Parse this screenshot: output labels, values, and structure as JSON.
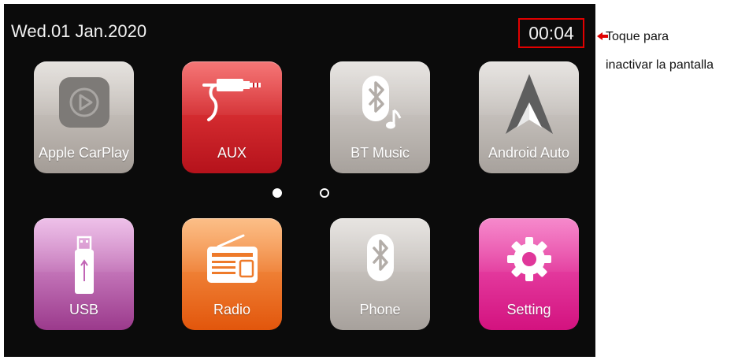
{
  "status_bar": {
    "date": "Wed.01 Jan.2020",
    "clock": "00:04"
  },
  "apps": [
    {
      "label": "Apple CarPlay",
      "icon": "carplay-icon"
    },
    {
      "label": "AUX",
      "icon": "aux-cable-icon"
    },
    {
      "label": "BT Music",
      "icon": "bluetooth-music-icon"
    },
    {
      "label": "Android Auto",
      "icon": "android-auto-icon"
    },
    {
      "label": "USB",
      "icon": "usb-drive-icon"
    },
    {
      "label": "Radio",
      "icon": "radio-icon"
    },
    {
      "label": "Phone",
      "icon": "bluetooth-phone-icon"
    },
    {
      "label": "Setting",
      "icon": "gear-icon"
    }
  ],
  "pager": {
    "pages": 2,
    "current": 1
  },
  "annotation": {
    "line1": "Toque para",
    "line2": "inactivar la pantalla",
    "color": "#e10000"
  }
}
